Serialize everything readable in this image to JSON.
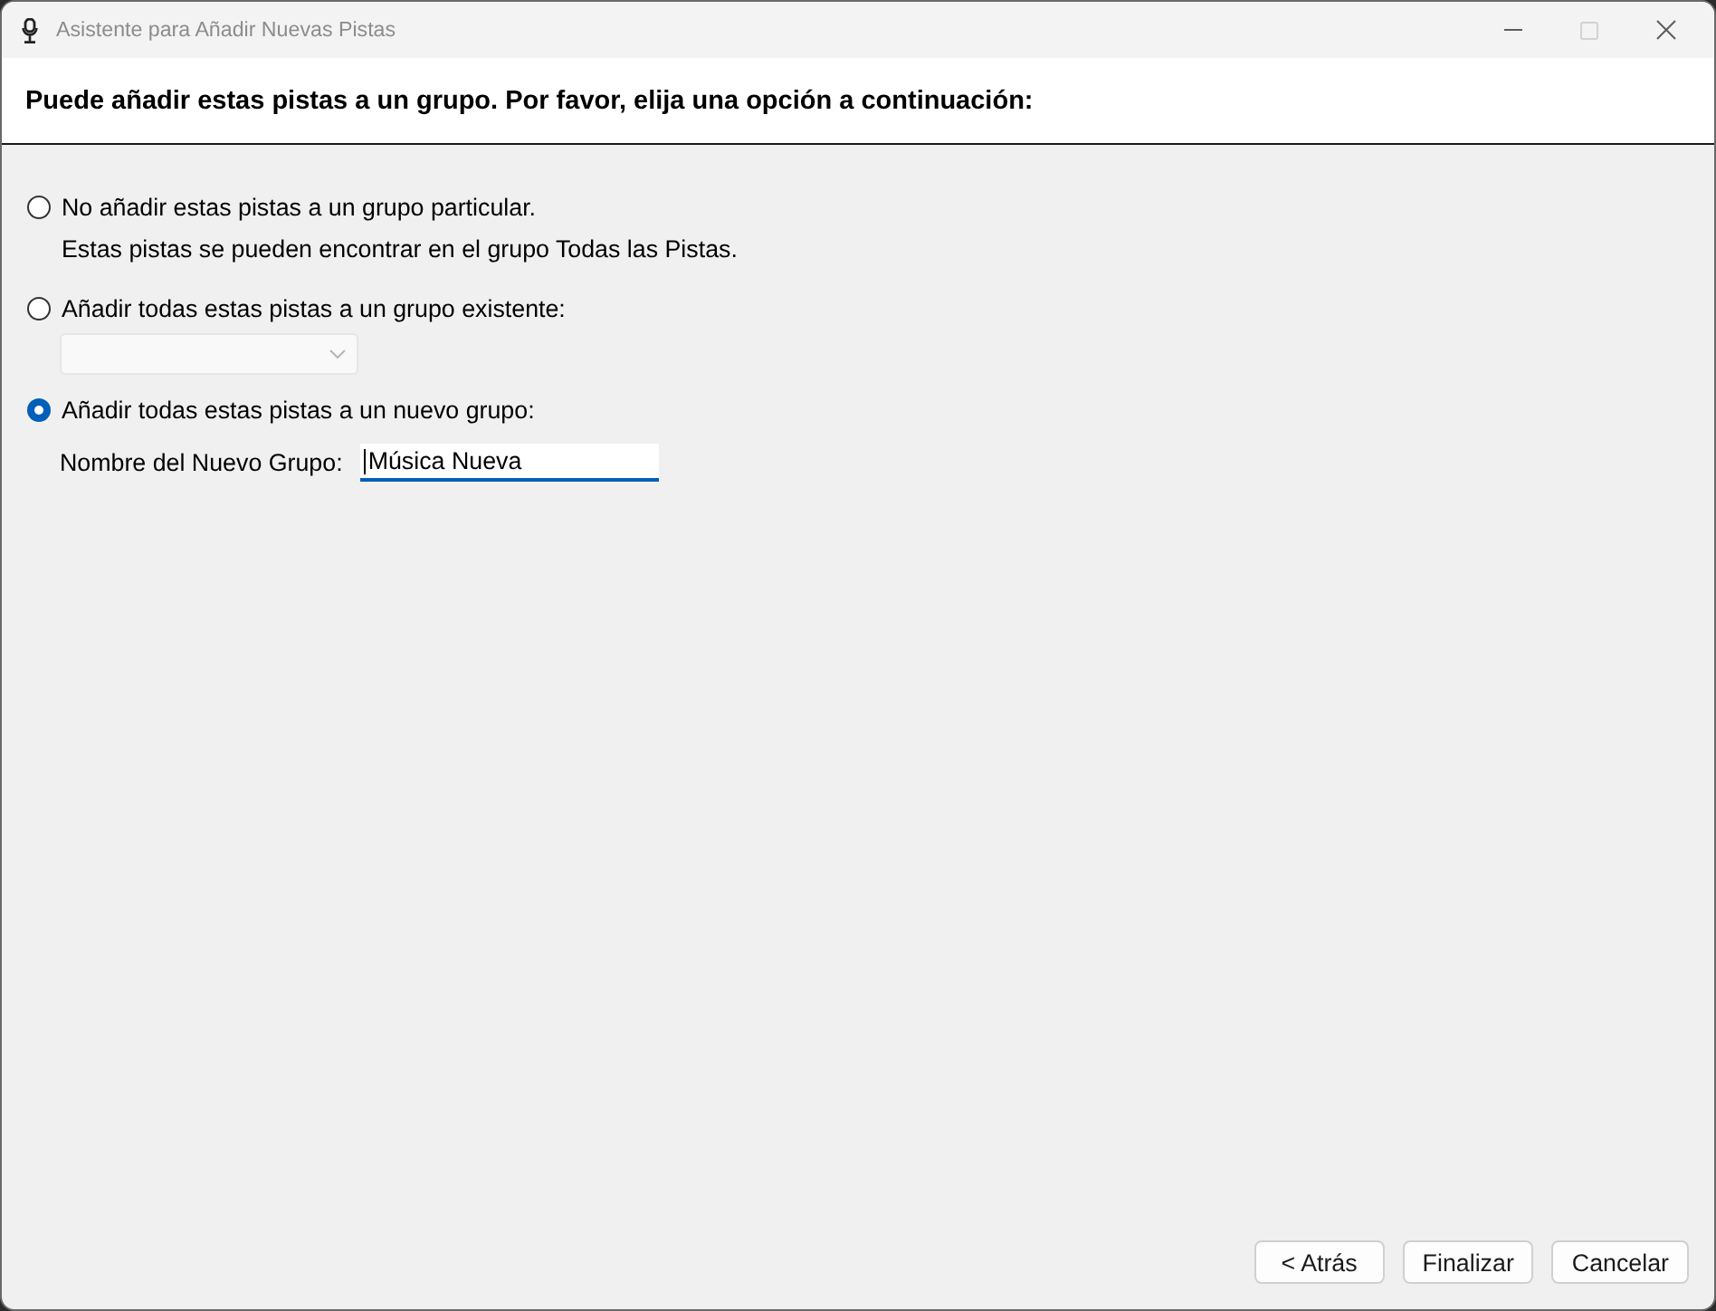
{
  "window": {
    "title": "Asistente para Añadir Nuevas Pistas",
    "maximize_disabled": true
  },
  "header": {
    "instruction": "Puede añadir estas pistas a un grupo. Por favor, elija una opción a continuación:"
  },
  "options": [
    {
      "kind": "plain",
      "label": "No añadir estas pistas a un grupo particular.",
      "selected": false,
      "note": "Estas pistas se pueden encontrar en el grupo Todas las Pistas."
    },
    {
      "kind": "dropdown",
      "label": "Añadir todas estas pistas a un grupo existente:",
      "selected": false,
      "dropdown": {
        "disabled": true
      }
    },
    {
      "kind": "textfield",
      "label": "Añadir todas estas pistas a un nuevo grupo:",
      "selected": true,
      "field": {
        "label": "Nombre del Nuevo Grupo:",
        "value": "Música Nueva",
        "focused": true
      }
    }
  ],
  "buttons": [
    {
      "label": "< Atrás"
    },
    {
      "label": "Finalizar"
    },
    {
      "label": "Cancelar"
    }
  ]
}
